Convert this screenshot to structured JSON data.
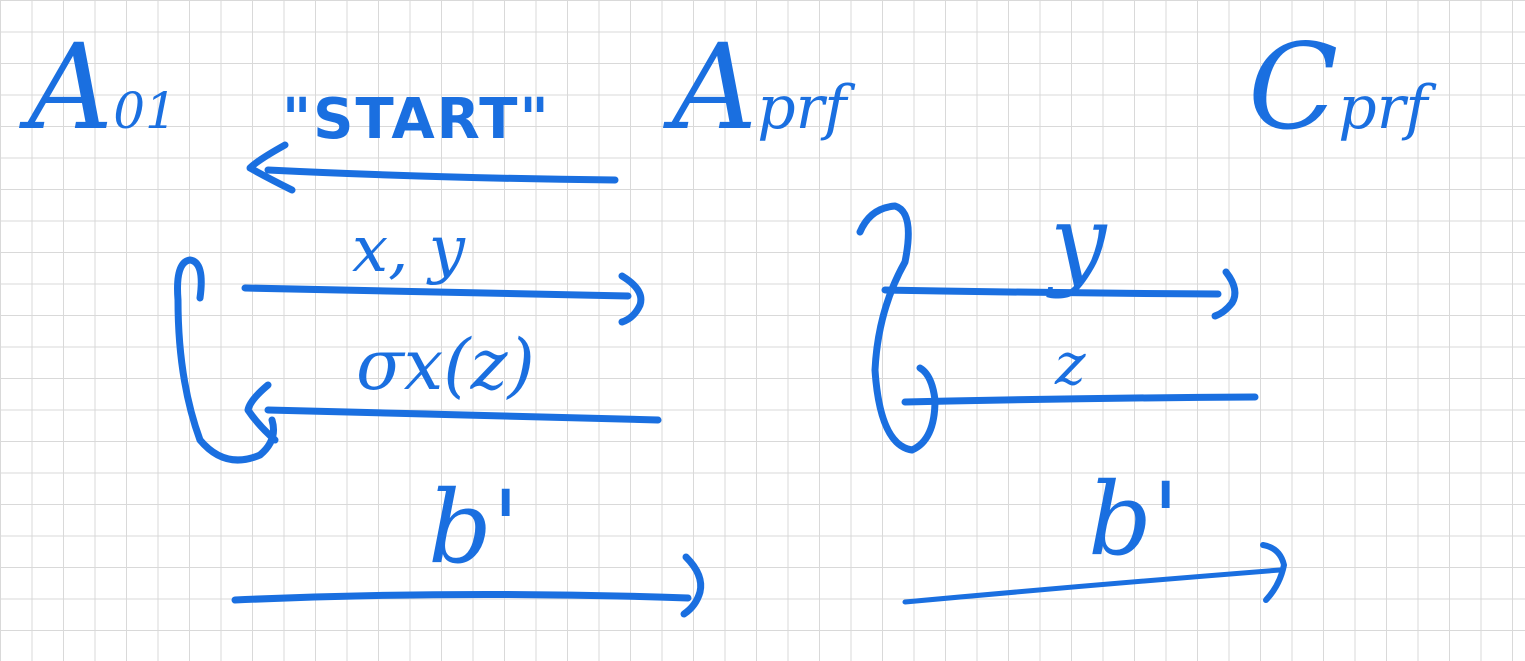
{
  "parties": {
    "left": "A",
    "left_sub": "01",
    "middle": "A",
    "middle_sub": "prf",
    "right": "C",
    "right_sub": "prf"
  },
  "left_exchange": {
    "start": "\"START\"",
    "query": "x, y",
    "reply": "σx(z)",
    "output": "b'"
  },
  "right_exchange": {
    "query": "y",
    "reply": "z",
    "output": "b'"
  },
  "colors": {
    "ink": "#1a6fe0",
    "grid": "#d9d9d9",
    "paper": "#ffffff"
  }
}
